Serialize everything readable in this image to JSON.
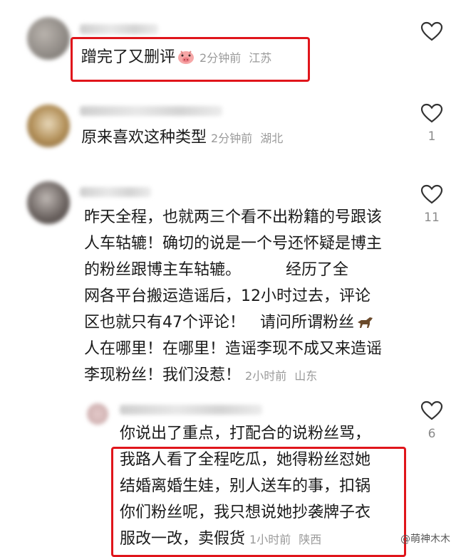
{
  "comments": [
    {
      "text": "蹭完了又删评",
      "time": "2分钟前",
      "location": "江苏",
      "likes": ""
    },
    {
      "text": "原来喜欢这种类型",
      "time": "2分钟前",
      "location": "湖北",
      "likes": "1"
    },
    {
      "text": "昨天全程，也就两三个看不出粉籍的号跟该人车轱辘！确切的说是一个号还怀疑是博主的粉丝跟博主车轱辘。",
      "text_lines": [
        "昨天全程，也就两三个看不出粉籍的号跟该",
        "人车轱辘！确切的说是一个号还怀疑是博主",
        "的粉丝跟博主车轱辘。         经历了全",
        "网各平台搬运造谣后，12小时过去，评论",
        "区也就只有47个评论！   请问所谓粉丝",
        "人在哪里！在哪里！造谣李现不成又来造谣",
        "李现粉丝！我们没惹！"
      ],
      "time": "2小时前",
      "location": "山东",
      "likes": "11"
    },
    {
      "text_lines": [
        "你说出了重点，打配合的说粉丝骂，",
        "我路人看了全程吃瓜，她得粉丝怼她",
        "结婚离婚生娃，别人送车的事，扣锅",
        "你们粉丝呢，我只想说她抄袭牌子衣",
        "服改一改，卖假货"
      ],
      "time": "1小时前",
      "location": "陕西",
      "likes": "6"
    }
  ],
  "watermark": "@萌神木木",
  "colors": {
    "highlight": "#e0151b",
    "meta": "#9a9a9a",
    "text": "#1a1a1a"
  }
}
